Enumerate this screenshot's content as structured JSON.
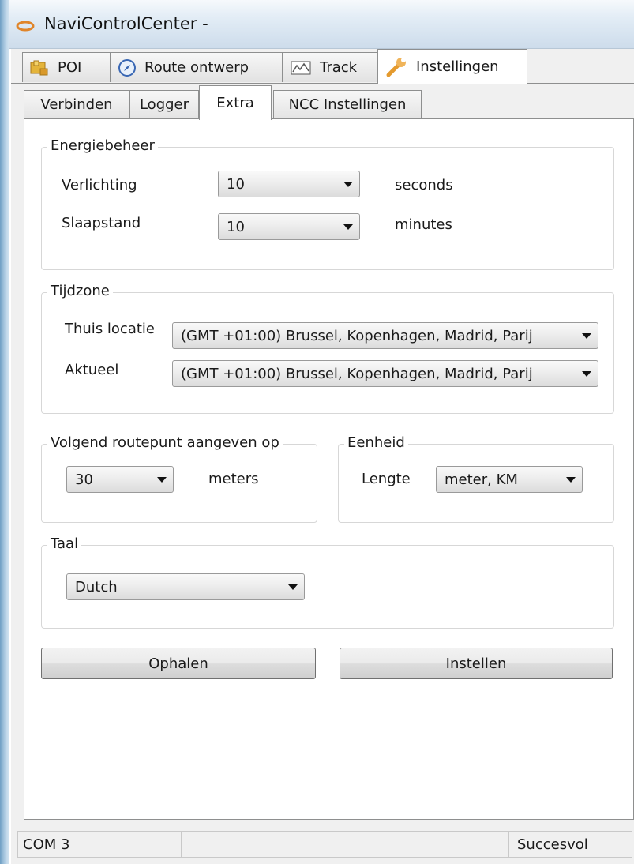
{
  "window": {
    "title": "NaviControlCenter -"
  },
  "main_tabs": [
    {
      "label": "POI",
      "icon": "poi-icon"
    },
    {
      "label": "Route ontwerp",
      "icon": "compass-icon"
    },
    {
      "label": "Track",
      "icon": "track-icon"
    },
    {
      "label": "Instellingen",
      "icon": "wrench-icon",
      "active": true
    }
  ],
  "sub_tabs": [
    {
      "label": "Verbinden"
    },
    {
      "label": "Logger"
    },
    {
      "label": "Extra",
      "active": true
    },
    {
      "label": "NCC Instellingen"
    }
  ],
  "energy": {
    "title": "Energiebeheer",
    "lighting_label": "Verlichting",
    "lighting_value": "10",
    "lighting_unit": "seconds",
    "sleep_label": "Slaapstand",
    "sleep_value": "10",
    "sleep_unit": "minutes"
  },
  "timezone": {
    "title": "Tijdzone",
    "home_label": "Thuis locatie",
    "home_value": "(GMT +01:00) Brussel, Kopenhagen, Madrid, Parij",
    "current_label": "Aktueel",
    "current_value": "(GMT +01:00) Brussel, Kopenhagen, Madrid, Parij"
  },
  "waypoint": {
    "title": "Volgend routepunt aangeven op",
    "value": "30",
    "unit": "meters"
  },
  "units": {
    "title": "Eenheid",
    "length_label": "Lengte",
    "length_value": "meter, KM"
  },
  "language": {
    "title": "Taal",
    "value": "Dutch"
  },
  "buttons": {
    "fetch": "Ophalen",
    "apply": "Instellen"
  },
  "status": {
    "port": "COM 3",
    "result": "Succesvol"
  },
  "colors": {
    "tab_border": "#8e8f8f",
    "titlebar": "#dde8f2",
    "group_border": "#d7d7d7"
  }
}
